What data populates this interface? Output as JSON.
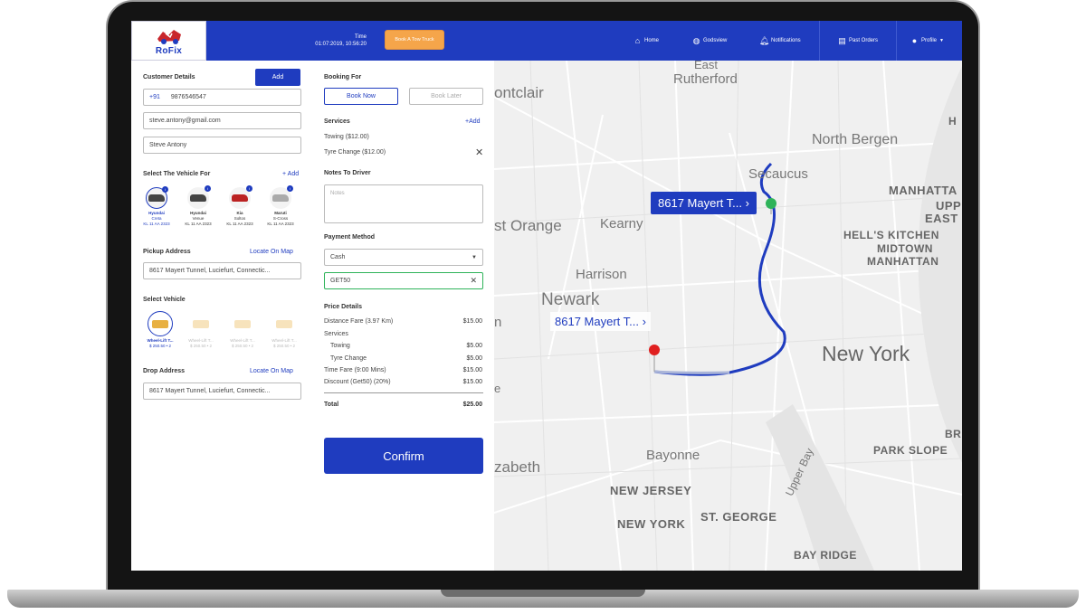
{
  "header": {
    "logo_text": "RoFix",
    "time_label": "Time",
    "time_value": "01:07:2019, 10:56:20",
    "book_tow_label": "Book A Tow Truck",
    "nav": {
      "home": "Home",
      "godsview": "Godsview",
      "notifications": "Notifications",
      "past_orders": "Past Orders",
      "profile": "Profile"
    }
  },
  "customer": {
    "title": "Customer Details",
    "add_label": "Add",
    "country_code": "+91",
    "phone": "9876546547",
    "email": "steve.antony@gmail.com",
    "name": "Steve Antony"
  },
  "vehicle_for": {
    "title": "Select The Vehicle For",
    "add_link": "+ Add",
    "items": [
      {
        "make": "Hyundai",
        "model": "Creta",
        "plate": "KL 11 AA 2323"
      },
      {
        "make": "Hyundai",
        "model": "Venue",
        "plate": "KL 11 AA 2323"
      },
      {
        "make": "Kia",
        "model": "Soltos",
        "plate": "KL 11 AA 2323"
      },
      {
        "make": "Maruti",
        "model": "S-Cross",
        "plate": "KL 11 AA 2323"
      }
    ],
    "badge": "i"
  },
  "pickup": {
    "title": "Pickup Address",
    "locate_link": "Locate On Map",
    "value": "8617 Mayert Tunnel, Luciefurt, Connectic..."
  },
  "select_vehicle": {
    "title": "Select Vehicle",
    "items": [
      {
        "name": "Wheel-Lift T...",
        "price": "$ 250.50 • 2"
      },
      {
        "name": "Wheel-Lift T...",
        "price": "$ 250.50 • 2"
      },
      {
        "name": "Wheel-Lift T...",
        "price": "$ 250.50 • 2"
      },
      {
        "name": "Wheel-Lift T...",
        "price": "$ 250.50 • 2"
      }
    ]
  },
  "drop": {
    "title": "Drop Address",
    "locate_link": "Locate On Map",
    "value": "8617 Mayert Tunnel, Luciefurt, Connectic..."
  },
  "booking": {
    "title": "Booking For",
    "book_now": "Book Now",
    "book_later": "Book Later"
  },
  "services": {
    "title": "Services",
    "add_link": "+Add",
    "items": [
      "Towing ($12.00)",
      "Tyre Change ($12.00)"
    ]
  },
  "notes": {
    "title": "Notes To Driver",
    "placeholder": "Notes"
  },
  "payment": {
    "title": "Payment Method",
    "method": "Cash",
    "coupon": "GET50"
  },
  "price": {
    "title": "Price Details",
    "rows": [
      {
        "label": "Distance Fare (3.97 Km)",
        "value": "$15.00"
      },
      {
        "label": "Services",
        "value": ""
      },
      {
        "label": "Towing",
        "value": "$5.00"
      },
      {
        "label": "Tyre Change",
        "value": "$5.00"
      },
      {
        "label": "Time Fare (9:00 Mins)",
        "value": "$15.00"
      },
      {
        "label": "Discount (Get50) (20%)",
        "value": "$15.00"
      }
    ],
    "total_label": "Total",
    "total_value": "$25.00"
  },
  "confirm_label": "Confirm",
  "map": {
    "places": [
      "East",
      "Rutherford",
      "ontclair",
      "North Bergen",
      "Secaucus",
      "MANHATTA",
      "UPP",
      "EAST",
      "st Orange",
      "Kearny",
      "HELL'S KITCHEN",
      "MIDTOWN",
      "MANHATTAN",
      "Harrison",
      "Newark",
      "n",
      "New York",
      "e",
      "Bayonne",
      "zabeth",
      "Upper Bay",
      "NEW JERSEY",
      "NEW YORK",
      "ST. GEORGE",
      "BR",
      "PARK SLOPE",
      "BAY RIDGE",
      "H"
    ],
    "pickup_tag": "8617 Mayert T...",
    "drop_tag": "8617 Mayert T...",
    "route_color": "#1f3cbf",
    "pickup_color": "#2fb35a",
    "drop_color": "#e02020"
  }
}
